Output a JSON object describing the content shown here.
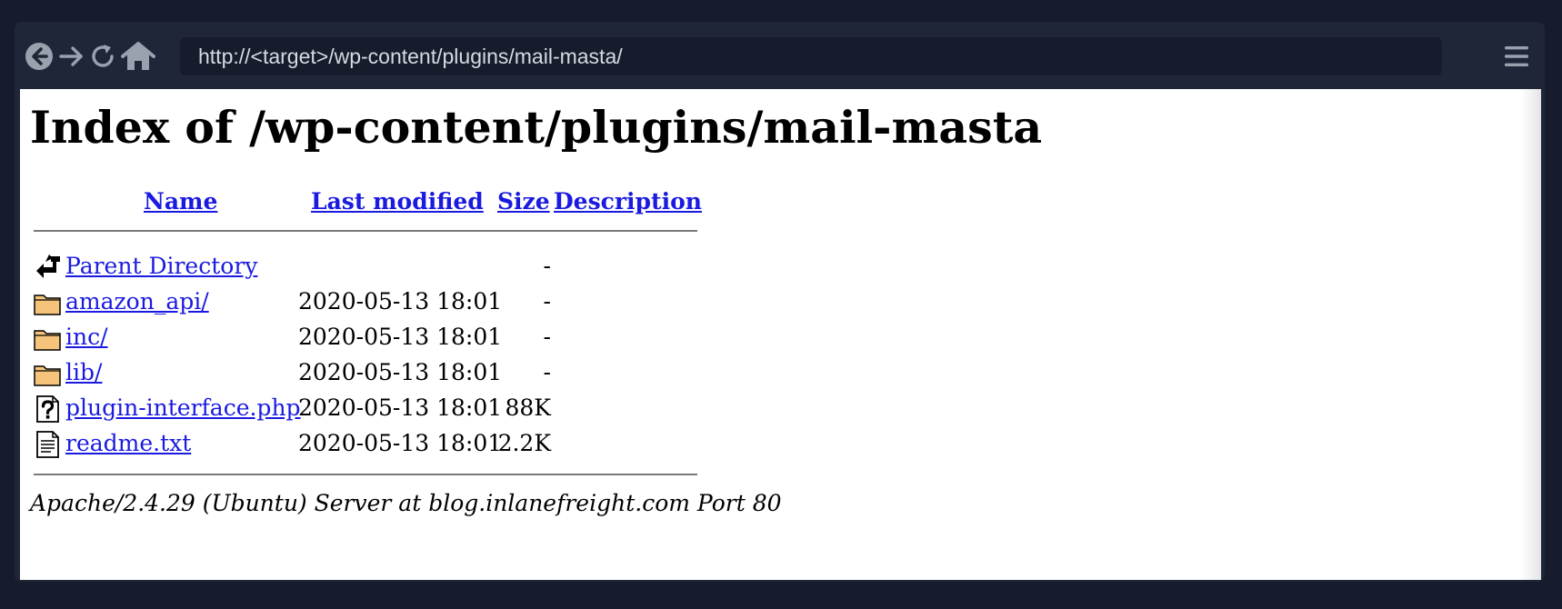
{
  "browser": {
    "url": "http://<target>/wp-content/plugins/mail-masta/"
  },
  "page": {
    "title": "Index of /wp-content/plugins/mail-masta",
    "columns": {
      "name": "Name",
      "last_modified": "Last modified",
      "size": "Size",
      "description": "Description"
    },
    "entries": [
      {
        "name": "Parent Directory",
        "modified": "",
        "size": "-",
        "icon": "back-icon"
      },
      {
        "name": "amazon_api/",
        "modified": "2020-05-13 18:01",
        "size": "-",
        "icon": "folder-icon"
      },
      {
        "name": "inc/",
        "modified": "2020-05-13 18:01",
        "size": "-",
        "icon": "folder-icon"
      },
      {
        "name": "lib/",
        "modified": "2020-05-13 18:01",
        "size": "-",
        "icon": "folder-icon"
      },
      {
        "name": "plugin-interface.php",
        "modified": "2020-05-13 18:01",
        "size": "88K",
        "icon": "unknown-file-icon"
      },
      {
        "name": "readme.txt",
        "modified": "2020-05-13 18:01",
        "size": "2.2K",
        "icon": "text-file-icon"
      }
    ],
    "address": "Apache/2.4.29 (Ubuntu) Server at blog.inlanefreight.com Port 80"
  },
  "colors": {
    "chrome": "#1f2637",
    "backdrop": "#161c2b",
    "link": "#1a1ae0",
    "url_text": "#d6dae3"
  }
}
